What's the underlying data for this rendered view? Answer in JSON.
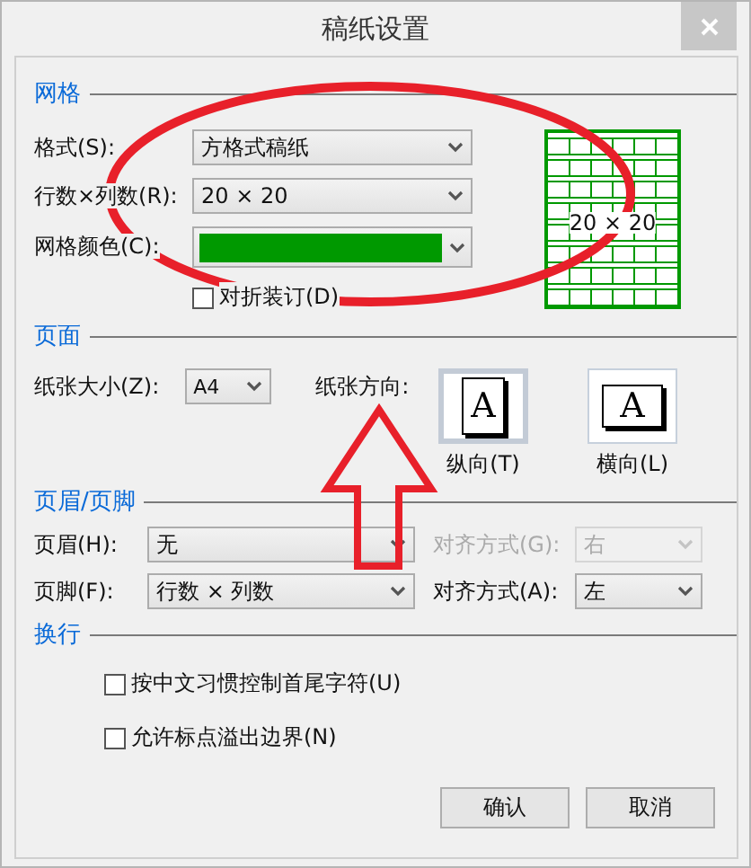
{
  "window": {
    "title": "稿纸设置"
  },
  "grid": {
    "title": "网格",
    "fields": [
      {
        "label": "格式(S):",
        "kind": "select",
        "value": "方格式稿纸"
      },
      {
        "label": "行数×列数(R):",
        "kind": "select",
        "value": "20 × 20"
      },
      {
        "label": "网格颜色(C):",
        "kind": "color",
        "color": "#009900"
      }
    ],
    "fold_binding": {
      "label": "对折装订(D)",
      "checked": false
    },
    "preview": {
      "text": "20 × 20"
    }
  },
  "page": {
    "title": "页面",
    "paper_size": {
      "label": "纸张大小(Z):",
      "value": "A4"
    },
    "orientation_label": "纸张方向:",
    "orientations": [
      {
        "label": "纵向(T)",
        "glyph": "A",
        "kind": "portrait",
        "selected": true
      },
      {
        "label": "横向(L)",
        "glyph": "A",
        "kind": "landscape",
        "selected": false
      }
    ]
  },
  "header_footer": {
    "title": "页眉/页脚",
    "rows": [
      {
        "label": "页眉(H):",
        "value": "无",
        "align_label": "对齐方式(G):",
        "align_value": "右",
        "align_disabled": true
      },
      {
        "label": "页脚(F):",
        "value": "行数 × 列数",
        "align_label": "对齐方式(A):",
        "align_value": "左",
        "align_disabled": false
      }
    ]
  },
  "line_break": {
    "title": "换行",
    "options": [
      {
        "label": "按中文习惯控制首尾字符(U)",
        "checked": false
      },
      {
        "label": "允许标点溢出边界(N)",
        "checked": false
      }
    ]
  },
  "buttons": [
    {
      "label": "确认"
    },
    {
      "label": "取消"
    }
  ],
  "annotations": {
    "ellipse": true,
    "arrow": true
  }
}
